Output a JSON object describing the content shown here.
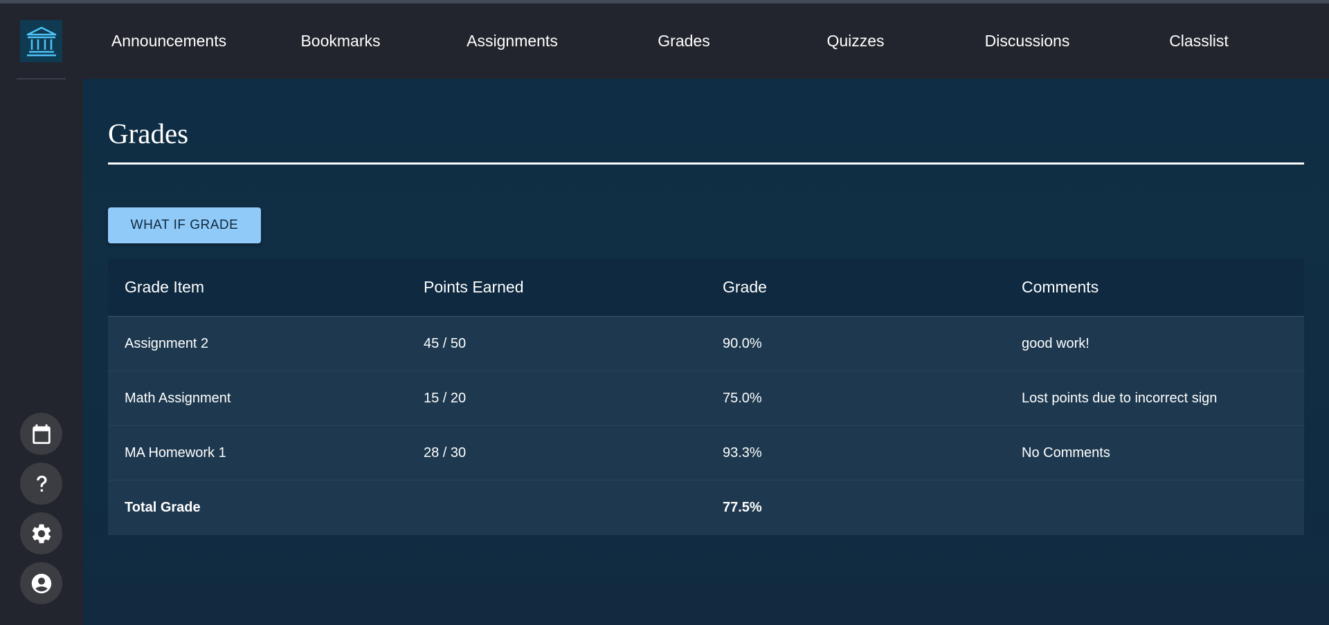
{
  "nav": {
    "items": [
      "Announcements",
      "Bookmarks",
      "Assignments",
      "Grades",
      "Quizzes",
      "Discussions",
      "Classlist"
    ]
  },
  "sidebar": {
    "logo_icon": "institution-icon",
    "buttons": [
      "calendar-icon",
      "help-icon",
      "settings-icon",
      "account-icon"
    ]
  },
  "page": {
    "title": "Grades",
    "what_if_label": "WHAT IF GRADE"
  },
  "table": {
    "headers": [
      "Grade Item",
      "Points Earned",
      "Grade",
      "Comments"
    ],
    "rows": [
      [
        "Assignment 2",
        "45 / 50",
        "90.0%",
        "good work!"
      ],
      [
        "Math Assignment",
        "15 / 20",
        "75.0%",
        "Lost points due to incorrect sign"
      ],
      [
        "MA Homework 1",
        "28 / 30",
        "93.3%",
        "No Comments"
      ]
    ],
    "total": {
      "label": "Total Grade",
      "grade": "77.5%"
    }
  },
  "colors": {
    "accent_button": "#90caf9",
    "main_bg": "#0f2e45",
    "sidebar_bg": "#22252d",
    "logo_accent": "#4fc3f7"
  }
}
